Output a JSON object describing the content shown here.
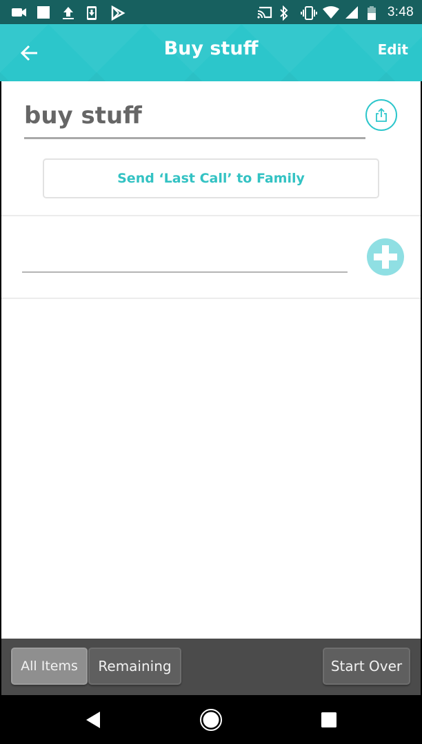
{
  "status_bar": {
    "time": "3:48",
    "left_icons": [
      "video-camera-icon",
      "square-notification-icon",
      "upload-icon",
      "phone-download-icon",
      "play-store-icon"
    ],
    "right_icons": [
      "cast-icon",
      "bluetooth-icon",
      "vibrate-icon",
      "wifi-icon",
      "cell-signal-icon",
      "battery-icon"
    ]
  },
  "app_bar": {
    "title": "Buy stuff",
    "edit_label": "Edit",
    "back_icon": "arrow-left-icon",
    "background_color": "#2cc6cb"
  },
  "list": {
    "name_value": "buy stuff",
    "share_icon": "share-icon",
    "last_call_label": "Send ‘Last Call’ to Family",
    "add_item_value": "",
    "add_item_placeholder": "",
    "add_icon": "plus-icon",
    "items": []
  },
  "bottom_bar": {
    "all_items_label": "All Items",
    "remaining_label": "Remaining",
    "start_over_label": "Start Over",
    "selected_filter": "All Items"
  },
  "nav_bar": {
    "icons": [
      "back-triangle-icon",
      "home-circle-icon",
      "recents-square-icon"
    ]
  },
  "colors": {
    "accent": "#2cc6cb",
    "status_bar": "#17605f",
    "bottom_bar": "#4b4b4b"
  }
}
